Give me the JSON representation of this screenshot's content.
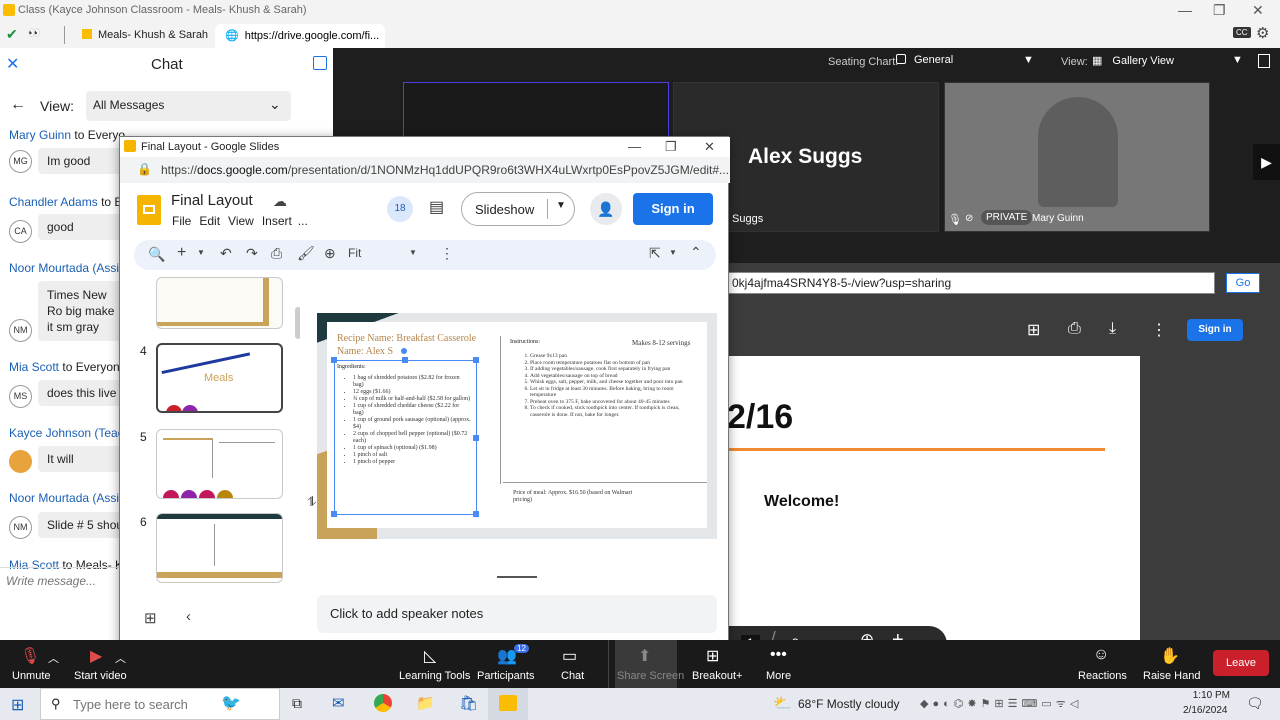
{
  "window": {
    "title": "Class (Kayce Johnson Classroom - Meals- Khush & Sarah)"
  },
  "tabs": [
    {
      "label": "Meals- Khush & Sarah"
    },
    {
      "label": "https://drive.google.com/fi..."
    }
  ],
  "chat": {
    "title": "Chat",
    "view_label": "View:",
    "view_value": "All Messages",
    "messages": [
      {
        "sender": "Mary Guinn",
        "to": "to Everyo",
        "initials": "MG",
        "text": "Im good"
      },
      {
        "sender": "Chandler Adams",
        "to": "to Ev",
        "initials": "CA",
        "text": "good"
      },
      {
        "sender": "Noor Mourtada (Assi",
        "to": "",
        "initials": "NM",
        "text": "Times New Ro big make it sm gray"
      },
      {
        "sender": "Mia Scott",
        "to": "to Everyone",
        "initials": "MS",
        "text": "does this live l"
      },
      {
        "sender": "Kayce Johnson (Teach",
        "to": "",
        "initials": "",
        "text": "It will"
      },
      {
        "sender": "Noor Mourtada (Assi",
        "to": "",
        "initials": "NM",
        "text": "Slide # 5 shoul"
      },
      {
        "sender": "Mia Scott",
        "to": "to Meals- K",
        "initials": "",
        "text": ""
      }
    ],
    "placeholder": "Write message..."
  },
  "zoom": {
    "seating_label": "Seating Chart:",
    "seating_value": "General",
    "view_label": "View:",
    "view_value": "Gallery View",
    "participant_big": "Alex Suggs",
    "participant_small": "Suggs",
    "private_badge": "PRIVATE",
    "mary_name": "Mary Guinn",
    "drive_url": "0kj4ajfma4SRN4Y8-5-/view?usp=sharing",
    "go_label": "Go",
    "signin_label": "Sign in",
    "slide_date": "2/16",
    "slide_welcome": "Welcome!",
    "page_label": "e",
    "page_current": "1",
    "page_total": "3"
  },
  "slides": {
    "window_title": "Final Layout - Google Slides",
    "url_prefix": "https://",
    "url_domain": "docs.google.com",
    "url_rest": "/presentation/d/1NONMzHq1ddUPQR9ro6t3WHX4uLWxrtp0EsPpovZ5JGM/edit#...",
    "doc_title": "Final Layout",
    "menu": [
      "File",
      "Edit",
      "View",
      "Insert",
      "..."
    ],
    "badge": "18",
    "slideshow_label": "Slideshow",
    "signin_label": "Sign in",
    "zoom_value": "Fit",
    "thumb_numbers": [
      "4",
      "5",
      "6"
    ],
    "thumb4_label": "Meals",
    "notes_placeholder": "Click to add speaker notes",
    "recipe": {
      "name": "Recipe Name: Breakfast Casserole",
      "author": "Name: Alex S",
      "ingredients_label": "Ingredients:",
      "ingredients": [
        "1 bag of shredded potatoes ($2.82 for frozen bag)",
        "12 eggs ($1.66)",
        "¾ cup of milk or half-and-half ($2.58 for gallon)",
        "1 cup of shredded cheddar cheese ($2.22 for bag)",
        "1 cup of ground pork sausage (optional) (approx. $4)",
        "2 cups of chopped bell pepper (optional) ($0.72 each)",
        "1 cup of spinach (optional) ($1.98)",
        "1 pinch of salt",
        "1 pinch of pepper"
      ],
      "instructions_label": "Instructions:",
      "servings": "Makes 8-12 servings",
      "instructions": [
        "Grease 9x13 pan",
        "Place room temperature potatoes flat on bottom of pan",
        "If adding vegetables/sausage, cook first separately in frying pan",
        "Add vegetables/sausage on top of bread",
        "Whisk eggs, salt, pepper, milk, and cheese together and pour into pan",
        "Let sit in fridge at least 30 minutes. Before baking, bring to room temperature",
        "Preheat oven to 375 F, bake uncovered for about 40-45 minutes",
        "To check if cooked, stick toothpick into center. If toothpick is clean, casserole is done. If not, bake for longer."
      ],
      "price": "Price of meal: Approx. $16.50 (based on Walmart pricing)"
    }
  },
  "zoombar": {
    "unmute": "Unmute",
    "start_video": "Start video",
    "learning_tools": "Learning Tools",
    "participants": "Participants",
    "participants_count": "12",
    "chat": "Chat",
    "share_screen": "Share Screen",
    "breakout": "Breakout+",
    "more": "More",
    "reactions": "Reactions",
    "raise_hand": "Raise Hand",
    "leave": "Leave"
  },
  "taskbar": {
    "search_placeholder": "Type here to search",
    "weather": "68°F  Mostly cloudy",
    "time": "1:10 PM",
    "date": "2/16/2024"
  },
  "colors": {
    "accent": "#1a73e8",
    "slide_gold": "#c9a35a",
    "slide_teal": "#1f3a3e",
    "leave": "#c9202b",
    "orange_line": "#f28b30"
  }
}
